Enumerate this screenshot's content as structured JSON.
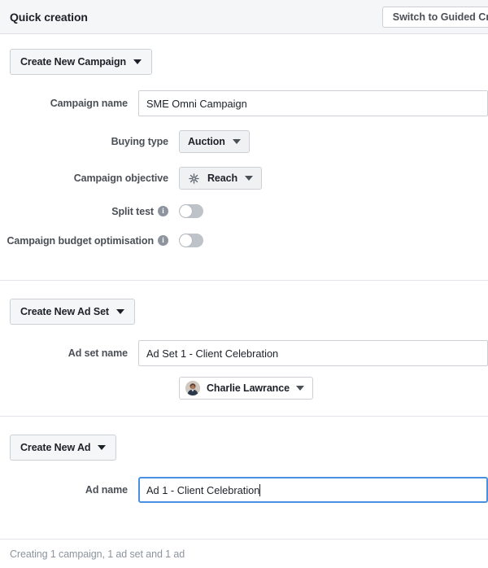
{
  "header": {
    "title": "Quick creation",
    "switch_label": "Switch to Guided Creation"
  },
  "campaign": {
    "create_button": "Create New Campaign",
    "name_label": "Campaign name",
    "name_value": "SME Omni Campaign",
    "buying_type_label": "Buying type",
    "buying_type_value": "Auction",
    "objective_label": "Campaign objective",
    "objective_value": "Reach",
    "objective_icon": "reach-starburst-icon",
    "split_test_label": "Split test",
    "split_test_state": "off",
    "budget_optimisation_label": "Campaign budget optimisation",
    "budget_optimisation_state": "off",
    "info_glyph": "i"
  },
  "adset": {
    "create_button": "Create New Ad Set",
    "name_label": "Ad set name",
    "name_value": "Ad Set 1 - Client Celebration",
    "account_name": "Charlie Lawrance"
  },
  "ad": {
    "create_button": "Create New Ad",
    "name_label": "Ad name",
    "name_value": "Ad 1 - Client Celebration"
  },
  "footer": {
    "summary": "Creating 1 campaign, 1 ad set and 1 ad"
  },
  "colors": {
    "header_bg": "#f5f6f7",
    "focus_blue": "#4a90e2",
    "label_gray": "#4b4f56",
    "muted_gray": "#8d949e",
    "border": "#ccd0d5"
  }
}
